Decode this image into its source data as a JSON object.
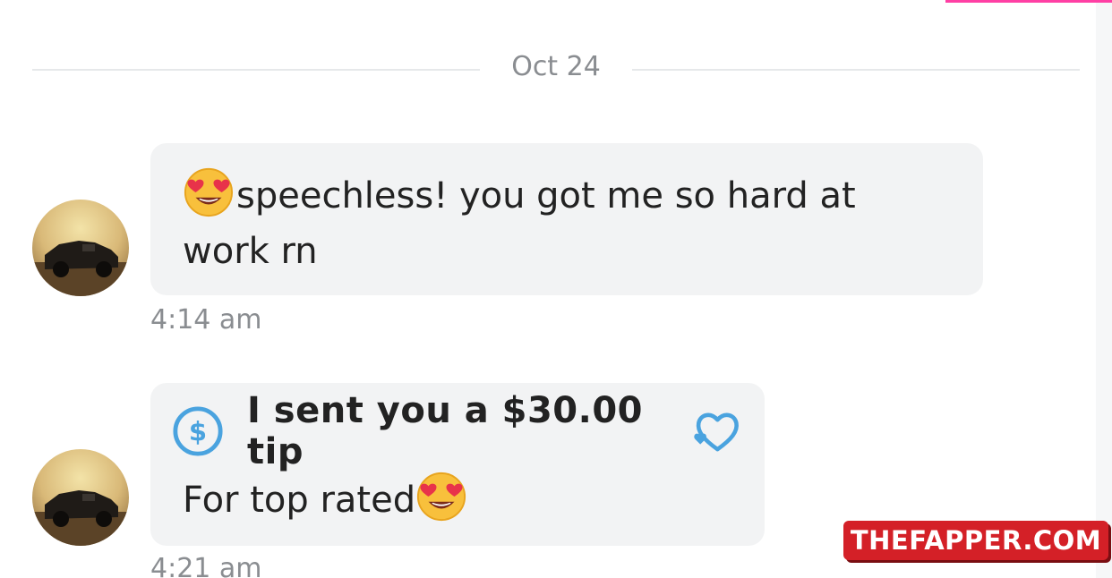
{
  "date_divider": "Oct 24",
  "messages": [
    {
      "emoji": "heart-eyes-emoji",
      "text": "speechless! you got me so hard at work rn",
      "time": "4:14 am"
    },
    {
      "tip_label": "I sent you a $30.00 tip",
      "text": "For top rated",
      "emoji": "heart-eyes-emoji",
      "time": "4:21 am"
    }
  ],
  "colors": {
    "bubble": "#f2f3f4",
    "tip_accent": "#4aa3df",
    "timestamp": "#8a8d91",
    "top_accent": "#ff3fa4",
    "watermark_bg": "#d42027"
  },
  "watermark": "THEFAPPER.COM"
}
